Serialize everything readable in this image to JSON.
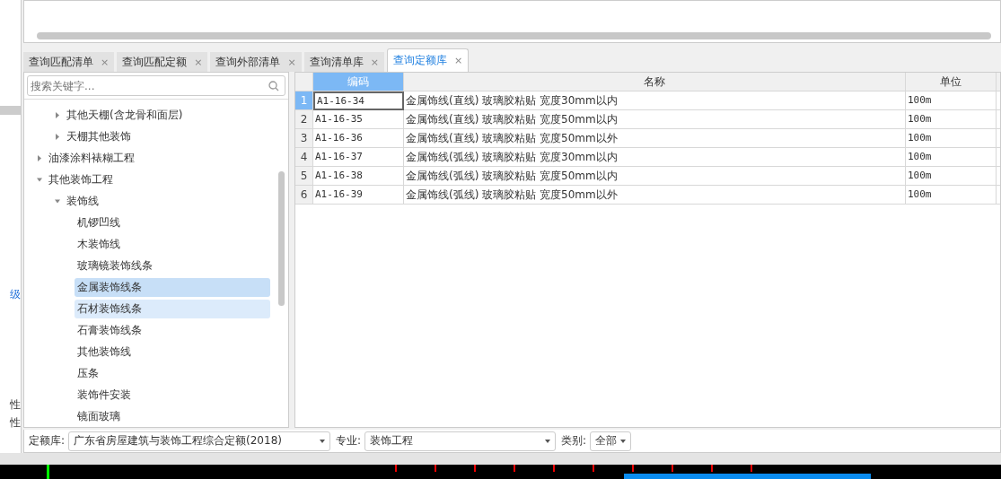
{
  "left_panel": {
    "cells": [
      {
        "text": "级",
        "link": true
      },
      {
        "text": "性",
        "link": false
      },
      {
        "text": "性",
        "link": false
      }
    ]
  },
  "tabs": [
    {
      "label": "查询匹配清单",
      "selected": false,
      "close": "×"
    },
    {
      "label": "查询匹配定额",
      "selected": false,
      "close": "×"
    },
    {
      "label": "查询外部清单",
      "selected": false,
      "close": "×"
    },
    {
      "label": "查询清单库",
      "selected": false,
      "close": "×"
    },
    {
      "label": "查询定额库",
      "selected": true,
      "close": "×"
    }
  ],
  "search": {
    "placeholder": "搜索关键字..."
  },
  "tree": {
    "partial_children": [
      {
        "label": "其他天棚(含龙骨和面层)",
        "expanded": false,
        "selected": false,
        "hovered": false
      },
      {
        "label": "天棚其他装饰",
        "expanded": false,
        "selected": false,
        "hovered": false
      }
    ],
    "items": [
      {
        "label": "油漆涂料裱糊工程",
        "expanded": false,
        "selected": false,
        "hovered": false
      },
      {
        "label": "其他装饰工程",
        "expanded": true,
        "selected": false,
        "hovered": false,
        "children": [
          {
            "label": "装饰线",
            "expanded": true,
            "selected": false,
            "hovered": false,
            "children": [
              {
                "label": "机锣凹线",
                "selected": false,
                "hovered": false
              },
              {
                "label": "木装饰线",
                "selected": false,
                "hovered": false
              },
              {
                "label": "玻璃镜装饰线条",
                "selected": false,
                "hovered": false
              },
              {
                "label": "金属装饰线条",
                "selected": true,
                "hovered": false
              },
              {
                "label": "石材装饰线条",
                "selected": false,
                "hovered": true
              },
              {
                "label": "石膏装饰线条",
                "selected": false,
                "hovered": false
              },
              {
                "label": "其他装饰线",
                "selected": false,
                "hovered": false
              },
              {
                "label": "压条",
                "selected": false,
                "hovered": false
              },
              {
                "label": "装饰件安装",
                "selected": false,
                "hovered": false
              },
              {
                "label": "镜面玻璃",
                "selected": false,
                "hovered": false
              }
            ]
          }
        ]
      }
    ]
  },
  "table": {
    "columns": [
      {
        "label": "编码",
        "selected": true
      },
      {
        "label": "名称",
        "selected": false
      },
      {
        "label": "单位",
        "selected": false
      }
    ],
    "rows": [
      {
        "index": "1",
        "code": "A1-16-34",
        "name": "金属饰线(直线) 玻璃胶粘贴 宽度30mm以内",
        "unit": "100m",
        "selected": true
      },
      {
        "index": "2",
        "code": "A1-16-35",
        "name": "金属饰线(直线) 玻璃胶粘贴 宽度50mm以内",
        "unit": "100m",
        "selected": false
      },
      {
        "index": "3",
        "code": "A1-16-36",
        "name": "金属饰线(直线) 玻璃胶粘贴 宽度50mm以外",
        "unit": "100m",
        "selected": false
      },
      {
        "index": "4",
        "code": "A1-16-37",
        "name": "金属饰线(弧线) 玻璃胶粘贴 宽度30mm以内",
        "unit": "100m",
        "selected": false
      },
      {
        "index": "5",
        "code": "A1-16-38",
        "name": "金属饰线(弧线) 玻璃胶粘贴 宽度50mm以内",
        "unit": "100m",
        "selected": false
      },
      {
        "index": "6",
        "code": "A1-16-39",
        "name": "金属饰线(弧线) 玻璃胶粘贴 宽度50mm以外",
        "unit": "100m",
        "selected": false
      }
    ]
  },
  "filters": [
    {
      "label": "定额库:",
      "value": "广东省房屋建筑与装饰工程综合定额(2018)"
    },
    {
      "label": "专业:",
      "value": "装饰工程"
    },
    {
      "label": "类别:",
      "value": "全部"
    }
  ]
}
